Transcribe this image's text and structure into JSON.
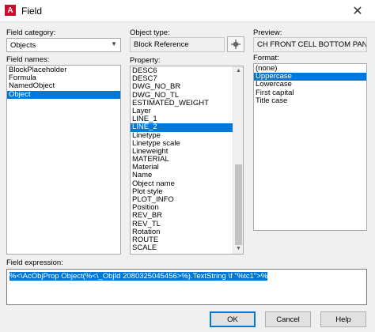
{
  "window": {
    "title": "Field",
    "close_glyph": "✕",
    "icon": "autocad-app-icon"
  },
  "field_category": {
    "label": "Field category:",
    "value": "Objects"
  },
  "field_names": {
    "label": "Field names:",
    "items": [
      {
        "text": "BlockPlaceholder",
        "selected": false
      },
      {
        "text": "Formula",
        "selected": false
      },
      {
        "text": "NamedObject",
        "selected": false
      },
      {
        "text": "Object",
        "selected": true
      }
    ]
  },
  "object_type": {
    "label": "Object type:",
    "value": "Block Reference"
  },
  "property": {
    "label": "Property:",
    "items": [
      {
        "text": "DESC6",
        "selected": false
      },
      {
        "text": "DESC7",
        "selected": false
      },
      {
        "text": "DWG_NO_BR",
        "selected": false
      },
      {
        "text": "DWG_NO_TL",
        "selected": false
      },
      {
        "text": "ESTIMATED_WEIGHT",
        "selected": false
      },
      {
        "text": "Layer",
        "selected": false
      },
      {
        "text": "LINE_1",
        "selected": false
      },
      {
        "text": "LINE_2",
        "selected": true
      },
      {
        "text": "Linetype",
        "selected": false
      },
      {
        "text": "Linetype scale",
        "selected": false
      },
      {
        "text": "Lineweight",
        "selected": false
      },
      {
        "text": "MATERIAL",
        "selected": false
      },
      {
        "text": "Material",
        "selected": false
      },
      {
        "text": "Name",
        "selected": false
      },
      {
        "text": "Object name",
        "selected": false
      },
      {
        "text": "Plot style",
        "selected": false
      },
      {
        "text": "PLOT_INFO",
        "selected": false
      },
      {
        "text": "Position",
        "selected": false
      },
      {
        "text": "REV_BR",
        "selected": false
      },
      {
        "text": "REV_TL",
        "selected": false
      },
      {
        "text": "Rotation",
        "selected": false
      },
      {
        "text": "ROUTE",
        "selected": false
      },
      {
        "text": "SCALE",
        "selected": false
      }
    ]
  },
  "preview": {
    "label": "Preview:",
    "value": "CH FRONT CELL BOTTOM PANEL"
  },
  "format": {
    "label": "Format:",
    "items": [
      {
        "text": "(none)",
        "selected": false
      },
      {
        "text": "Uppercase",
        "selected": true
      },
      {
        "text": "Lowercase",
        "selected": false
      },
      {
        "text": "First capital",
        "selected": false
      },
      {
        "text": "Title case",
        "selected": false
      }
    ]
  },
  "field_expression": {
    "label": "Field expression:",
    "value": "%<\\AcObjProp Object(%<\\_ObjId 2080325045456>%).TextString \\f \"%tc1\">%"
  },
  "buttons": {
    "ok": "OK",
    "cancel": "Cancel",
    "help": "Help"
  },
  "colors": {
    "selection": "#0078d7",
    "dialog_bg": "#f0f0f0",
    "app_icon": "#c8102e"
  }
}
